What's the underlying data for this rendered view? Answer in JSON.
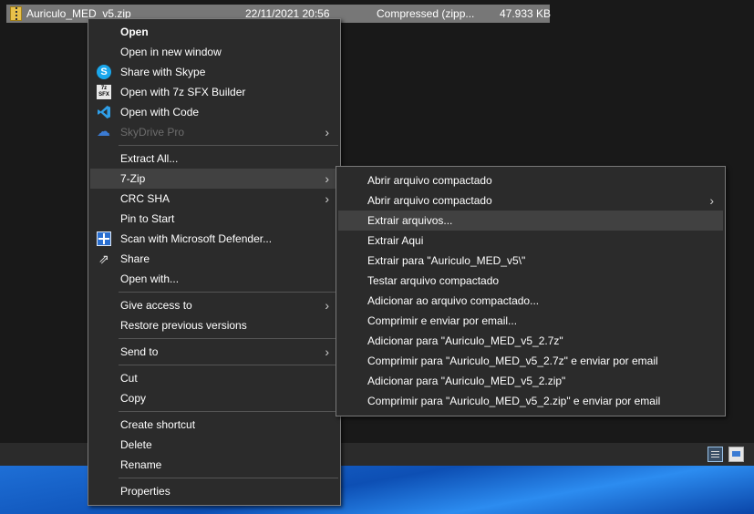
{
  "file": {
    "name": "Auriculo_MED_v5.zip",
    "date": "22/11/2021 20:56",
    "type": "Compressed (zipp...",
    "size": "47.933 KB"
  },
  "context_menu": {
    "items": [
      {
        "label": "Open"
      },
      {
        "label": "Open in new window"
      },
      {
        "label": "Share with Skype"
      },
      {
        "label": "Open with 7z SFX Builder"
      },
      {
        "label": "Open with Code"
      },
      {
        "label": "SkyDrive Pro"
      },
      {
        "label": "Extract All..."
      },
      {
        "label": "7-Zip"
      },
      {
        "label": "CRC SHA"
      },
      {
        "label": "Pin to Start"
      },
      {
        "label": "Scan with Microsoft Defender..."
      },
      {
        "label": "Share"
      },
      {
        "label": "Open with..."
      },
      {
        "label": "Give access to"
      },
      {
        "label": "Restore previous versions"
      },
      {
        "label": "Send to"
      },
      {
        "label": "Cut"
      },
      {
        "label": "Copy"
      },
      {
        "label": "Create shortcut"
      },
      {
        "label": "Delete"
      },
      {
        "label": "Rename"
      },
      {
        "label": "Properties"
      }
    ],
    "icons": {
      "7z_text": "7z\nSFX"
    }
  },
  "submenu_7zip": {
    "items": [
      {
        "label": "Abrir arquivo compactado"
      },
      {
        "label": "Abrir arquivo compactado"
      },
      {
        "label": "Extrair arquivos..."
      },
      {
        "label": "Extrair Aqui"
      },
      {
        "label": "Extrair para \"Auriculo_MED_v5\\\""
      },
      {
        "label": "Testar arquivo compactado"
      },
      {
        "label": "Adicionar ao arquivo compactado..."
      },
      {
        "label": "Comprimir e enviar por email..."
      },
      {
        "label": "Adicionar para \"Auriculo_MED_v5_2.7z\""
      },
      {
        "label": "Comprimir para \"Auriculo_MED_v5_2.7z\" e enviar por email"
      },
      {
        "label": "Adicionar para \"Auriculo_MED_v5_2.zip\""
      },
      {
        "label": "Comprimir para \"Auriculo_MED_v5_2.zip\" e enviar por email"
      }
    ]
  },
  "colors": {
    "menu_bg": "#2b2b2b",
    "hover_bg": "#414141",
    "selected_row": "#777777",
    "disabled_text": "#6d6d6d"
  }
}
